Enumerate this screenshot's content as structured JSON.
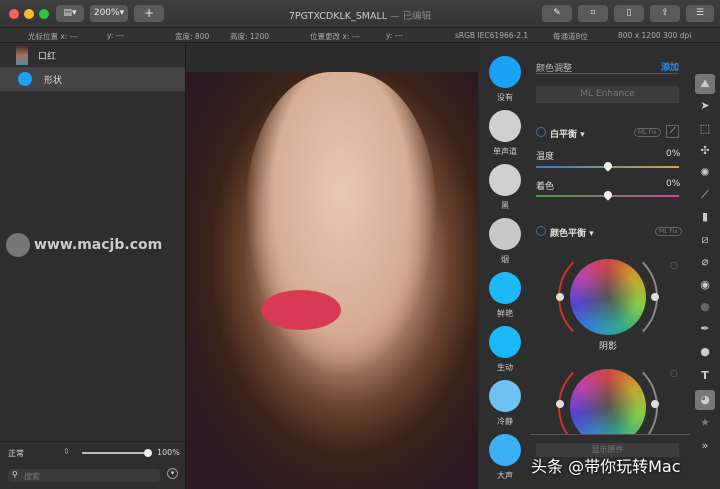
{
  "window": {
    "title": "7PGTXCDKLK_SMALL",
    "status": "— 已编辑",
    "zoom": "200%",
    "add": "+"
  },
  "info": {
    "cursor_x": "光标位置 x: ---",
    "cursor_y": "y: ---",
    "width": "宽度: 800",
    "height": "高度: 1200",
    "pos_x": "位置更改 x: ---",
    "pos_y": "y: ---",
    "profile": "sRGB IEC61966-2.1",
    "depth": "每通道8位",
    "size": "800 x 1200 300 dpi"
  },
  "layers": [
    {
      "label": "口红"
    },
    {
      "label": "形状"
    }
  ],
  "sidebar_footer": {
    "blend": "正常",
    "opacity": "100%",
    "search_placeholder": "搜索",
    "opacity_value": 1.0
  },
  "presets": [
    {
      "label": "没有",
      "color": "#1aa2f5"
    },
    {
      "label": "单声道",
      "color": "#cfcfcf"
    },
    {
      "label": "黑",
      "color": "#cfcfcf"
    },
    {
      "label": "烟",
      "color": "#c8c8c8"
    },
    {
      "label": "鲜艳",
      "color": "#1db8f8"
    },
    {
      "label": "生动",
      "color": "#1ab8f5"
    },
    {
      "label": "冷静",
      "color": "#6ec2f2"
    },
    {
      "label": "大声",
      "color": "#3bb0f5"
    }
  ],
  "adjust": {
    "header": "颜色调整",
    "add": "添加",
    "ml_enhance": "ML Enhance",
    "wb": "白平衡",
    "ml_fix": "ML Fix",
    "temp": "温度",
    "temp_val": "0%",
    "tint": "着色",
    "tint_val": "0%",
    "cb": "颜色平衡",
    "shadows": "阴影",
    "show_original": "显示原件"
  },
  "watermark": {
    "site": "www.macjb.com",
    "credit": "头条 @带你玩转Mac"
  },
  "accent": "#2a8cf0"
}
